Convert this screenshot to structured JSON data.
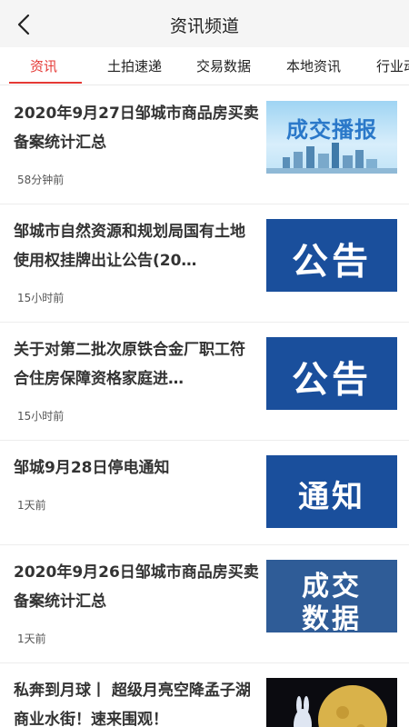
{
  "header": {
    "title": "资讯频道"
  },
  "tabs": [
    {
      "label": "资讯"
    },
    {
      "label": "土拍速递"
    },
    {
      "label": "交易数据"
    },
    {
      "label": "本地资讯"
    },
    {
      "label": "行业动"
    }
  ],
  "items": [
    {
      "title": "2020年9月27日邹城市商品房买卖备案统计汇总",
      "time": "58分钟前",
      "thumb_text": "成交播报"
    },
    {
      "title": "邹城市自然资源和规划局国有土地使用权挂牌出让公告(20…",
      "time": "15小时前",
      "thumb_text": "公告"
    },
    {
      "title": "关于对第二批次原铁合金厂职工符合住房保障资格家庭进…",
      "time": "15小时前",
      "thumb_text": "公告"
    },
    {
      "title": "邹城9月28日停电通知",
      "time": "1天前",
      "thumb_text": "通知"
    },
    {
      "title": "2020年9月26日邹城市商品房买卖备案统计汇总",
      "time": "1天前",
      "thumb_text_1": "成交",
      "thumb_text_2": "数据"
    },
    {
      "title": "私奔到月球丨 超级月亮空降孟子湖商业水街！速来围观！",
      "time": ""
    }
  ],
  "colors": {
    "accent": "#e53935",
    "thumb_blue": "#1a4f9c"
  }
}
